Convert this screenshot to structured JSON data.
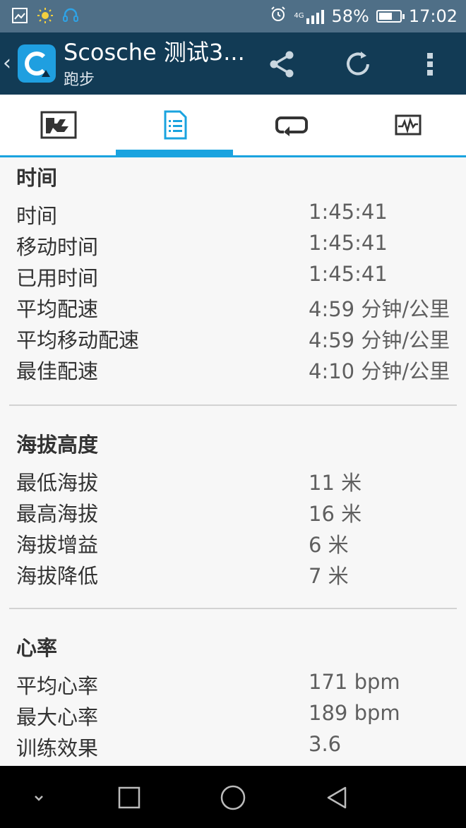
{
  "status_bar": {
    "battery_percent": "58%",
    "time": "17:02",
    "network_type": "4G",
    "icons": [
      "image-icon",
      "sun-icon",
      "headset-icon",
      "alarm-icon",
      "signal-icon",
      "battery-icon"
    ]
  },
  "app_bar": {
    "title": "Scosche 测试3...",
    "subtitle": "跑步",
    "actions": [
      "share-icon",
      "refresh-icon",
      "overflow-menu-icon"
    ]
  },
  "tabs": [
    {
      "name": "map-tab",
      "icon": "map-icon"
    },
    {
      "name": "stats-tab",
      "icon": "document-list-icon",
      "selected": true
    },
    {
      "name": "laps-tab",
      "icon": "loop-icon"
    },
    {
      "name": "charts-tab",
      "icon": "chart-icon"
    }
  ],
  "sections": [
    {
      "title": "时间",
      "rows": [
        {
          "label": "时间",
          "value": "1:45:41"
        },
        {
          "label": "移动时间",
          "value": "1:45:41"
        },
        {
          "label": "已用时间",
          "value": "1:45:41"
        },
        {
          "label": "平均配速",
          "value": "4:59 分钟/公里"
        },
        {
          "label": "平均移动配速",
          "value": "4:59 分钟/公里"
        },
        {
          "label": "最佳配速",
          "value": "4:10 分钟/公里"
        }
      ]
    },
    {
      "title": "海拔高度",
      "rows": [
        {
          "label": "最低海拔",
          "value": "11 米"
        },
        {
          "label": "最高海拔",
          "value": "16 米"
        },
        {
          "label": "海拔增益",
          "value": "6 米"
        },
        {
          "label": "海拔降低",
          "value": "7 米"
        }
      ]
    },
    {
      "title": "心率",
      "rows": [
        {
          "label": "平均心率",
          "value": "171 bpm"
        },
        {
          "label": "最大心率",
          "value": "189 bpm"
        },
        {
          "label": "训练效果",
          "value": "3.6"
        }
      ]
    }
  ],
  "colors": {
    "status_bar": "#4f6f87",
    "app_bar": "#123b55",
    "accent": "#1aa3df",
    "background": "#f7f7f7"
  },
  "nav_bar": {
    "buttons": [
      "chevron-down-icon",
      "recents-icon",
      "home-icon",
      "back-icon"
    ]
  }
}
